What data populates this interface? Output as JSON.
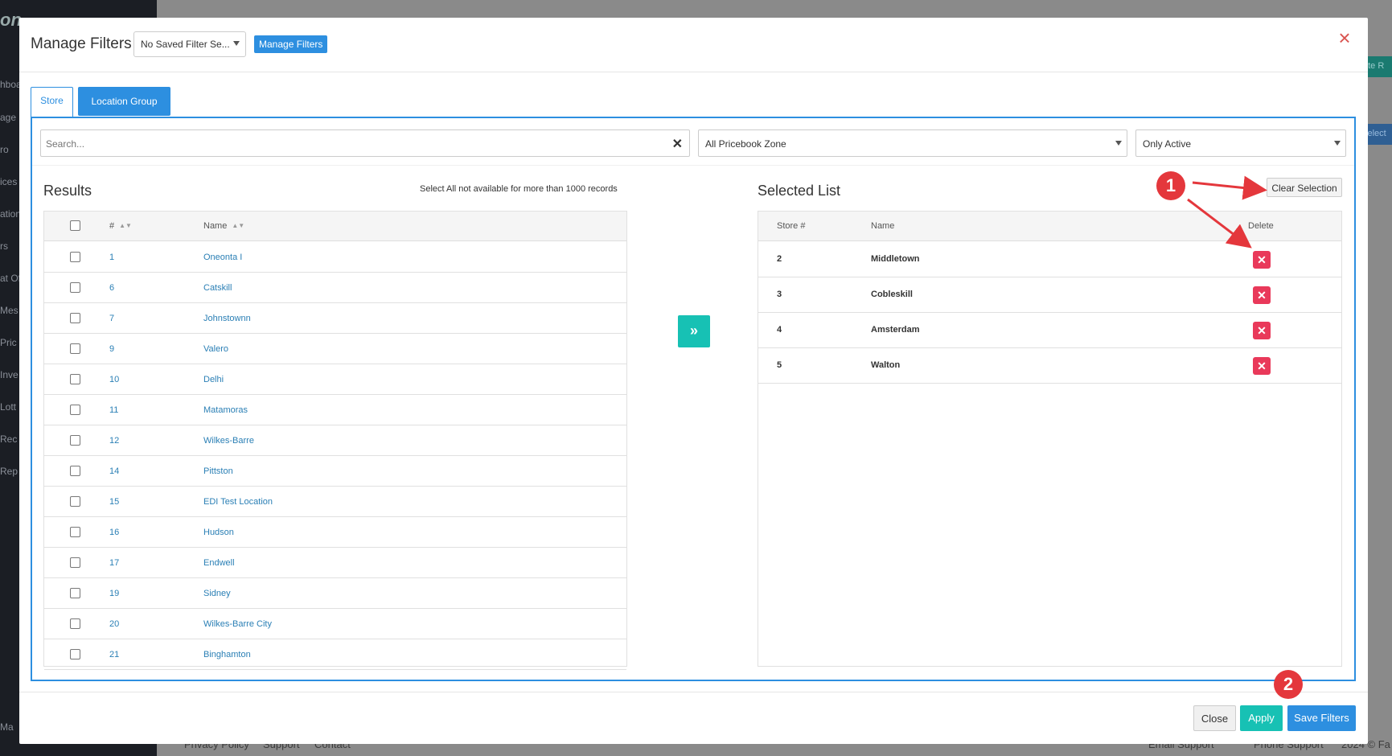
{
  "background": {
    "logo": "on ...",
    "sidebar_items": [
      "hboa",
      "age",
      "ro",
      "ices",
      "ation",
      "rs",
      "at Of",
      "Mes",
      "Pric",
      "Inve",
      "Lott",
      "Rec",
      "Rep",
      "Ma"
    ],
    "right_buttons": [
      "ate R",
      "select"
    ],
    "footer_links": [
      "Privacy Policy",
      "Support",
      "Contact"
    ],
    "footer_right": [
      "Email Support",
      "Phone Support",
      "2024 © Fa"
    ]
  },
  "modal": {
    "title": "Manage Filters",
    "saved_filter_select": "No Saved Filter Se...",
    "manage_button": "Manage Filters",
    "tabs": [
      {
        "label": "Store",
        "active": true
      },
      {
        "label": "Location Group",
        "active": false
      }
    ],
    "search": {
      "placeholder": "Search...",
      "value": ""
    },
    "zone_select": "All Pricebook Zone",
    "status_select": "Only Active",
    "results": {
      "title": "Results",
      "note": "Select All not available for more than 1000 records",
      "columns": [
        "#",
        "Name"
      ],
      "rows": [
        {
          "num": "1",
          "name": "Oneonta I"
        },
        {
          "num": "6",
          "name": "Catskill"
        },
        {
          "num": "7",
          "name": "Johnstownn"
        },
        {
          "num": "9",
          "name": "Valero"
        },
        {
          "num": "10",
          "name": "Delhi"
        },
        {
          "num": "11",
          "name": "Matamoras"
        },
        {
          "num": "12",
          "name": "Wilkes-Barre"
        },
        {
          "num": "14",
          "name": "Pittston"
        },
        {
          "num": "15",
          "name": "EDI Test Location"
        },
        {
          "num": "16",
          "name": "Hudson"
        },
        {
          "num": "17",
          "name": "Endwell"
        },
        {
          "num": "19",
          "name": "Sidney"
        },
        {
          "num": "20",
          "name": "Wilkes-Barre City"
        },
        {
          "num": "21",
          "name": "Binghamton"
        }
      ]
    },
    "move_button_icon": "»",
    "selected": {
      "title": "Selected List",
      "clear_button": "Clear Selection",
      "columns": [
        "Store #",
        "Name",
        "Delete"
      ],
      "rows": [
        {
          "store": "2",
          "name": "Middletown"
        },
        {
          "store": "3",
          "name": "Cobleskill"
        },
        {
          "store": "4",
          "name": "Amsterdam"
        },
        {
          "store": "5",
          "name": "Walton"
        }
      ]
    },
    "footer": {
      "close": "Close",
      "apply": "Apply",
      "save": "Save Filters"
    }
  },
  "annotations": {
    "callout_1": "1",
    "callout_2": "2",
    "color": "#e4373c"
  },
  "colors": {
    "primary": "#2d8fe0",
    "teal": "#17c1b4",
    "danger": "#e9395a",
    "close_x": "#d9534f"
  }
}
